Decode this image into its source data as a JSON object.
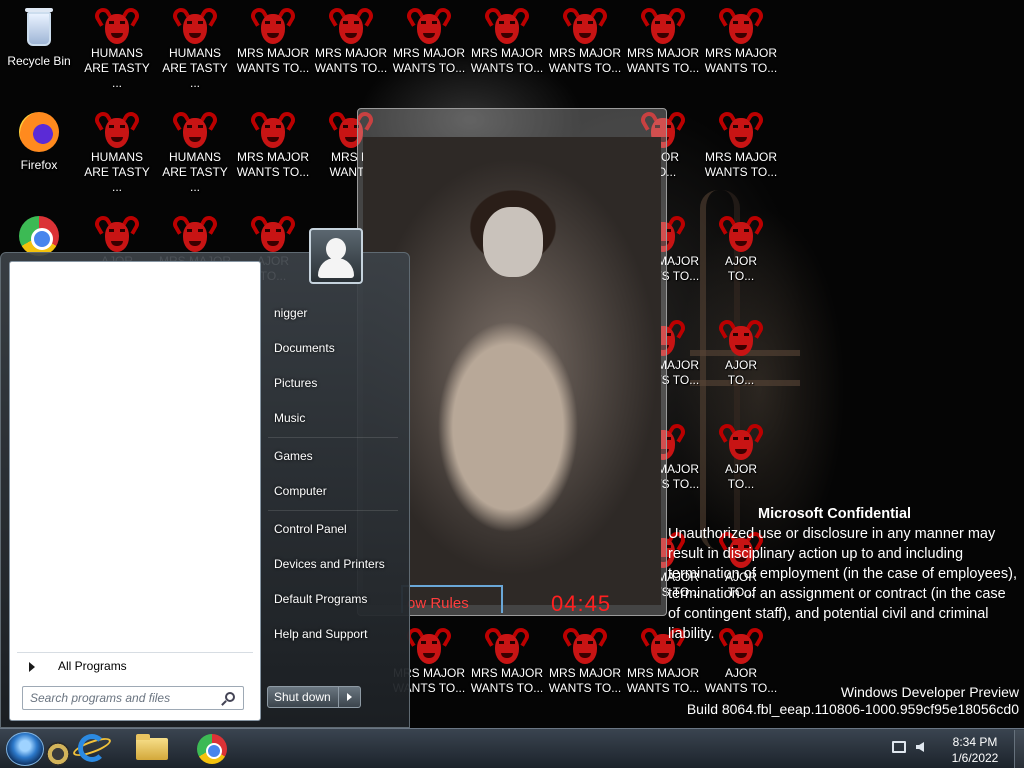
{
  "desktop": {
    "icons_col0": [
      {
        "label": "Recycle Bin",
        "icon": "recycle-bin-icon"
      },
      {
        "label": "Firefox",
        "icon": "firefox-icon"
      },
      {
        "label": "",
        "icon": "chrome-icon"
      }
    ],
    "devil_icons": [
      {
        "label": "HUMANS\nARE TASTY ..."
      },
      {
        "label": "HUMANS\nARE TASTY ..."
      },
      {
        "label": "MRS MAJOR\nWANTS TO..."
      },
      {
        "label": "MRS MAJOR\nWANTS TO..."
      },
      {
        "label": "MRS MAJOR\nWANTS TO..."
      },
      {
        "label": "MRS MAJOR\nWANTS TO..."
      },
      {
        "label": "MRS MAJOR\nWANTS TO..."
      },
      {
        "label": "MRS MAJOR\nWANTS TO..."
      },
      {
        "label": "MRS MAJOR\nWANTS TO..."
      },
      {
        "label": "HUMANS\nARE TASTY ..."
      },
      {
        "label": "HUMANS\nARE TASTY ..."
      },
      {
        "label": "MRS MAJOR\nWANTS TO..."
      },
      {
        "label": "MRS M\nWANTS"
      },
      {
        "label": "AJOR\nTO..."
      },
      {
        "label": "MRS MAJOR\nWANTS TO..."
      },
      {
        "label": "AJOR\nTO..."
      },
      {
        "label": "MRS MAJOR\nWANTS TO..."
      },
      {
        "label": "AJOR\nTO..."
      },
      {
        "label": "MRS MAJOR\nWANTS TO..."
      },
      {
        "label": "AJOR\nTO..."
      },
      {
        "label": "MRS MAJOR\nWANTS TO..."
      },
      {
        "label": "AJOR\nTO..."
      },
      {
        "label": "MRS MAJOR\nWANTS TO..."
      },
      {
        "label": "AJOR\nTO..."
      },
      {
        "label": "MRS MAJOR\nWANTS TO..."
      },
      {
        "label": "AJOR\nTO..."
      },
      {
        "label": "MRS MAJOR\nWANTS TO..."
      },
      {
        "label": "AJOR\nWANTS TO..."
      },
      {
        "label": "MRS MAJOR\nWANTS TO..."
      },
      {
        "label": "MRS MAJOR\nWANTS TO..."
      },
      {
        "label": "MRS MAJOR\nWANTS TO..."
      },
      {
        "label": "MRS MAJOR\nWANTS TO..."
      },
      {
        "label": "MRS MAJOR\nWANTS TO..."
      },
      {
        "label": "MRS MAJOR\nWANTS TO..."
      }
    ],
    "devil_color": "#c81414"
  },
  "popup": {
    "rules_button": "ow Rules",
    "timer": "04:45",
    "timer_color": "#ff2020"
  },
  "watermark": {
    "title": "Microsoft Confidential",
    "body": "Unauthorized use or disclosure in any manner may result in disciplinary action up to and including termination of employment (in the case of employees), termination of an assignment or contract (in the case of contingent staff), and potential civil and criminal liability.",
    "build_line1": "Windows Developer Preview",
    "build_line2": "Build 8064.fbl_eeap.110806-1000.959cf95e18056cd0"
  },
  "start_menu": {
    "user_items": [
      "nigger",
      "Documents",
      "Pictures",
      "Music",
      "Games",
      "Computer",
      "Control Panel",
      "Devices and Printers",
      "Default Programs",
      "Help and Support"
    ],
    "all_programs": "All Programs",
    "search_placeholder": "Search programs and files",
    "shutdown": "Shut down"
  },
  "taskbar": {
    "apps": [
      "start-orb",
      "gauge-icon",
      "internet-explorer-icon",
      "file-explorer-icon",
      "chrome-icon"
    ],
    "time": "8:34 PM",
    "date": "1/6/2022"
  }
}
